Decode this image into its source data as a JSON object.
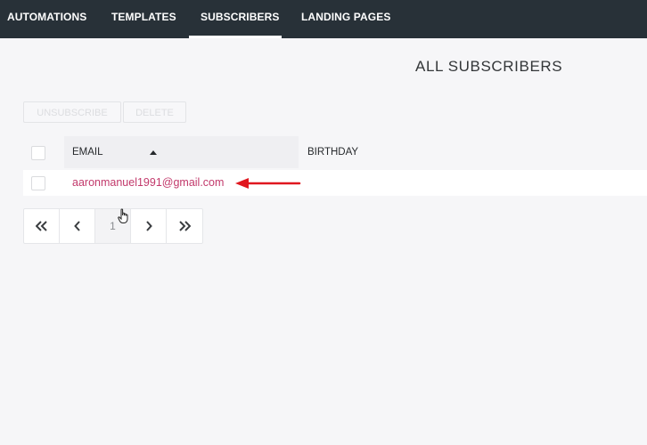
{
  "nav": {
    "tabs": [
      {
        "label": "AUTOMATIONS"
      },
      {
        "label": "TEMPLATES"
      },
      {
        "label": "SUBSCRIBERS"
      },
      {
        "label": "LANDING PAGES"
      }
    ],
    "active_tab": "SUBSCRIBERS"
  },
  "page": {
    "title": "ALL SUBSCRIBERS"
  },
  "actions": {
    "unsubscribe_label": "UNSUBSCRIBE",
    "delete_label": "DELETE"
  },
  "table": {
    "columns": [
      {
        "label": "EMAIL",
        "sort": "ascending"
      },
      {
        "label": "BIRTHDAY"
      }
    ],
    "rows": [
      {
        "email": "aaronmanuel1991@gmail.com",
        "birthday": ""
      }
    ]
  },
  "pagination": {
    "first_icon": "double-chevron-left-icon",
    "prev_icon": "chevron-left-icon",
    "current_page": "1",
    "next_icon": "chevron-right-icon",
    "last_icon": "double-chevron-right-icon"
  },
  "colors": {
    "nav_bg": "#283138",
    "link": "#c2396b",
    "arrow": "#e0171f"
  }
}
